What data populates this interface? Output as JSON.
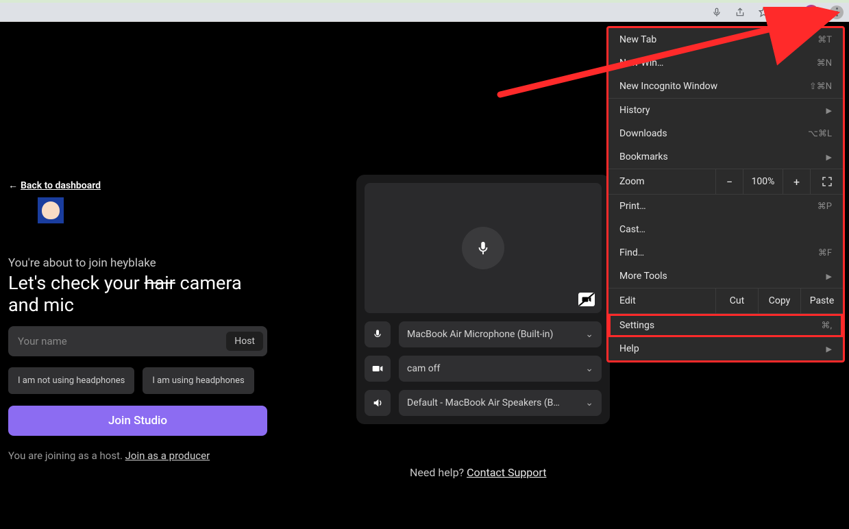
{
  "browser_menu": {
    "new_tab": "New Tab",
    "new_tab_sc": "⌘T",
    "new_window": "New Win…",
    "new_window_sc": "⌘N",
    "incognito": "New Incognito Window",
    "incognito_sc": "⇧⌘N",
    "history": "History",
    "downloads": "Downloads",
    "downloads_sc": "⌥⌘L",
    "bookmarks": "Bookmarks",
    "zoom_label": "Zoom",
    "zoom_value": "100%",
    "print": "Print…",
    "print_sc": "⌘P",
    "cast": "Cast…",
    "find": "Find…",
    "find_sc": "⌘F",
    "more_tools": "More Tools",
    "edit": "Edit",
    "cut": "Cut",
    "copy": "Copy",
    "paste": "Paste",
    "settings": "Settings",
    "settings_sc": "⌘,",
    "help": "Help"
  },
  "page": {
    "back": "Back to dashboard",
    "about_join": "You're about to join heyblake",
    "check_pre": "Let's check your ",
    "check_strike": "hair",
    "check_post": " camera and mic",
    "name_placeholder": "Your name",
    "host_badge": "Host",
    "hp_no": "I am not using headphones",
    "hp_yes": "I am using headphones",
    "join_btn": "Join Studio",
    "host_note": "You are joining as a host. ",
    "producer_link": "Join as a producer",
    "mic_device": "MacBook Air Microphone (Built-in)",
    "cam_device": "cam off",
    "speaker_device": "Default - MacBook Air Speakers (B…",
    "need_help": "Need help? ",
    "contact": "Contact Support"
  }
}
